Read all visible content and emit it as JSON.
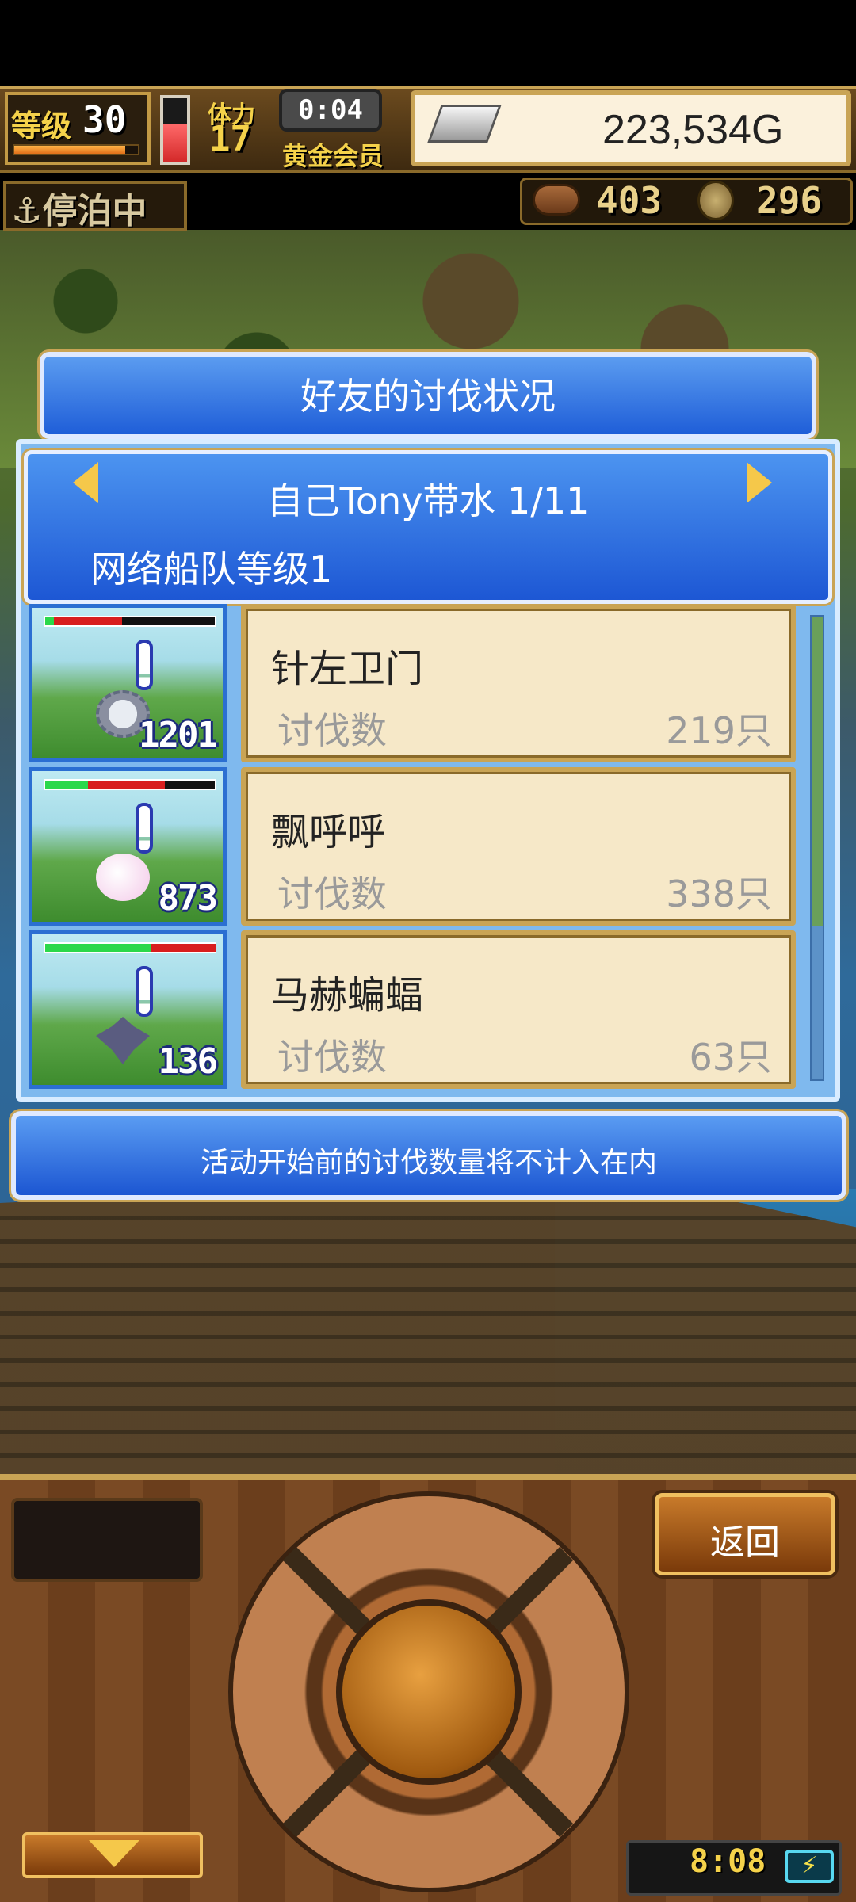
{
  "status": {
    "level_label": "等级",
    "level": "30",
    "level_progress": 0.9,
    "health_fill": 0.6,
    "stamina_label": "体力",
    "stamina": "17",
    "timer": "0:04",
    "membership": "黄金会员",
    "gold": "223,534G",
    "dock_status": "停泊中",
    "resource_1": "403",
    "resource_2": "296"
  },
  "dialog": {
    "title": "好友的讨伐状况",
    "header_name": "自己Tony带水 1/11",
    "header_sub": "网络船队等级1",
    "notice": "活动开始前的讨伐数量将不计入在内",
    "rows": [
      {
        "name": "针左卫门",
        "kill_label": "讨伐数",
        "kill_count": "219只",
        "thumb_number": "1201",
        "hp_green": 0.05,
        "hp_red": 0.4,
        "monster": "spiky-monster"
      },
      {
        "name": "飘呼呼",
        "kill_label": "讨伐数",
        "kill_count": "338只",
        "thumb_number": "873",
        "hp_green": 0.25,
        "hp_red": 0.45,
        "monster": "puff-monster"
      },
      {
        "name": "马赫蝙蝠",
        "kill_label": "讨伐数",
        "kill_count": "63只",
        "thumb_number": "136",
        "hp_green": 0.62,
        "hp_red": 0.38,
        "monster": "bat-monster"
      }
    ]
  },
  "controls": {
    "back_label": "返回",
    "clock": "8:08",
    "battery_icon": "⚡"
  },
  "colors": {
    "dialog_blue": "#1f5ed8",
    "card_beige": "#f6e8c8",
    "gold_text": "#f5d24a"
  }
}
